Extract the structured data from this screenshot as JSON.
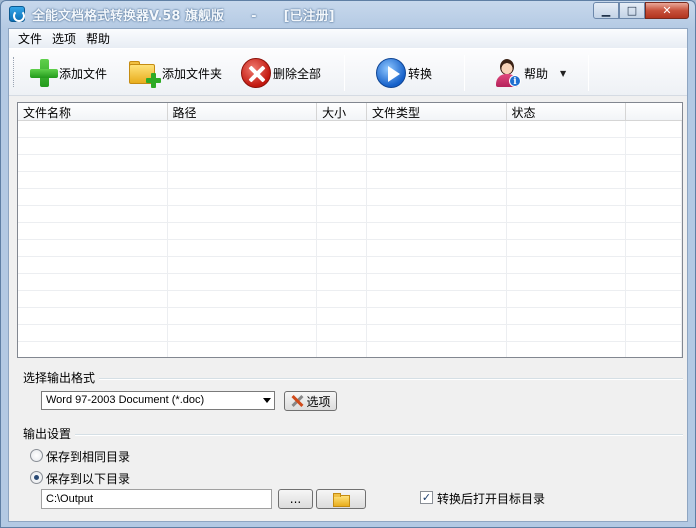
{
  "window": {
    "title": "全能文档格式转换器V.58 旗舰版      -      [已注册]",
    "minimize": "▁",
    "maximize": "□",
    "close": "✕"
  },
  "menu": [
    "文件",
    "选项",
    "帮助"
  ],
  "toolbar": {
    "add_file": "添加文件",
    "add_folder": "添加文件夹",
    "delete_all": "删除全部",
    "convert": "转换",
    "help": "帮助",
    "help_dropdown": "▼"
  },
  "file_list": {
    "columns": [
      "文件名称",
      "路径",
      "大小",
      "文件类型",
      "状态"
    ],
    "rows": []
  },
  "output_format": {
    "group_label": "选择输出格式",
    "selected": "Word 97-2003 Document (*.doc)",
    "options_button": "选项"
  },
  "output_settings": {
    "group_label": "输出设置",
    "same_dir_label": "保存到相同目录",
    "same_dir_checked": false,
    "custom_dir_label": "保存到以下目录",
    "custom_dir_checked": true,
    "path": "C:\\Output",
    "browse_button": "...",
    "open_after_label": "转换后打开目标目录",
    "open_after_checked": true
  },
  "colors": {
    "titlebar": "#b9cde5",
    "client_bg": "#f0f0f0",
    "close_button": "#c7513b"
  }
}
